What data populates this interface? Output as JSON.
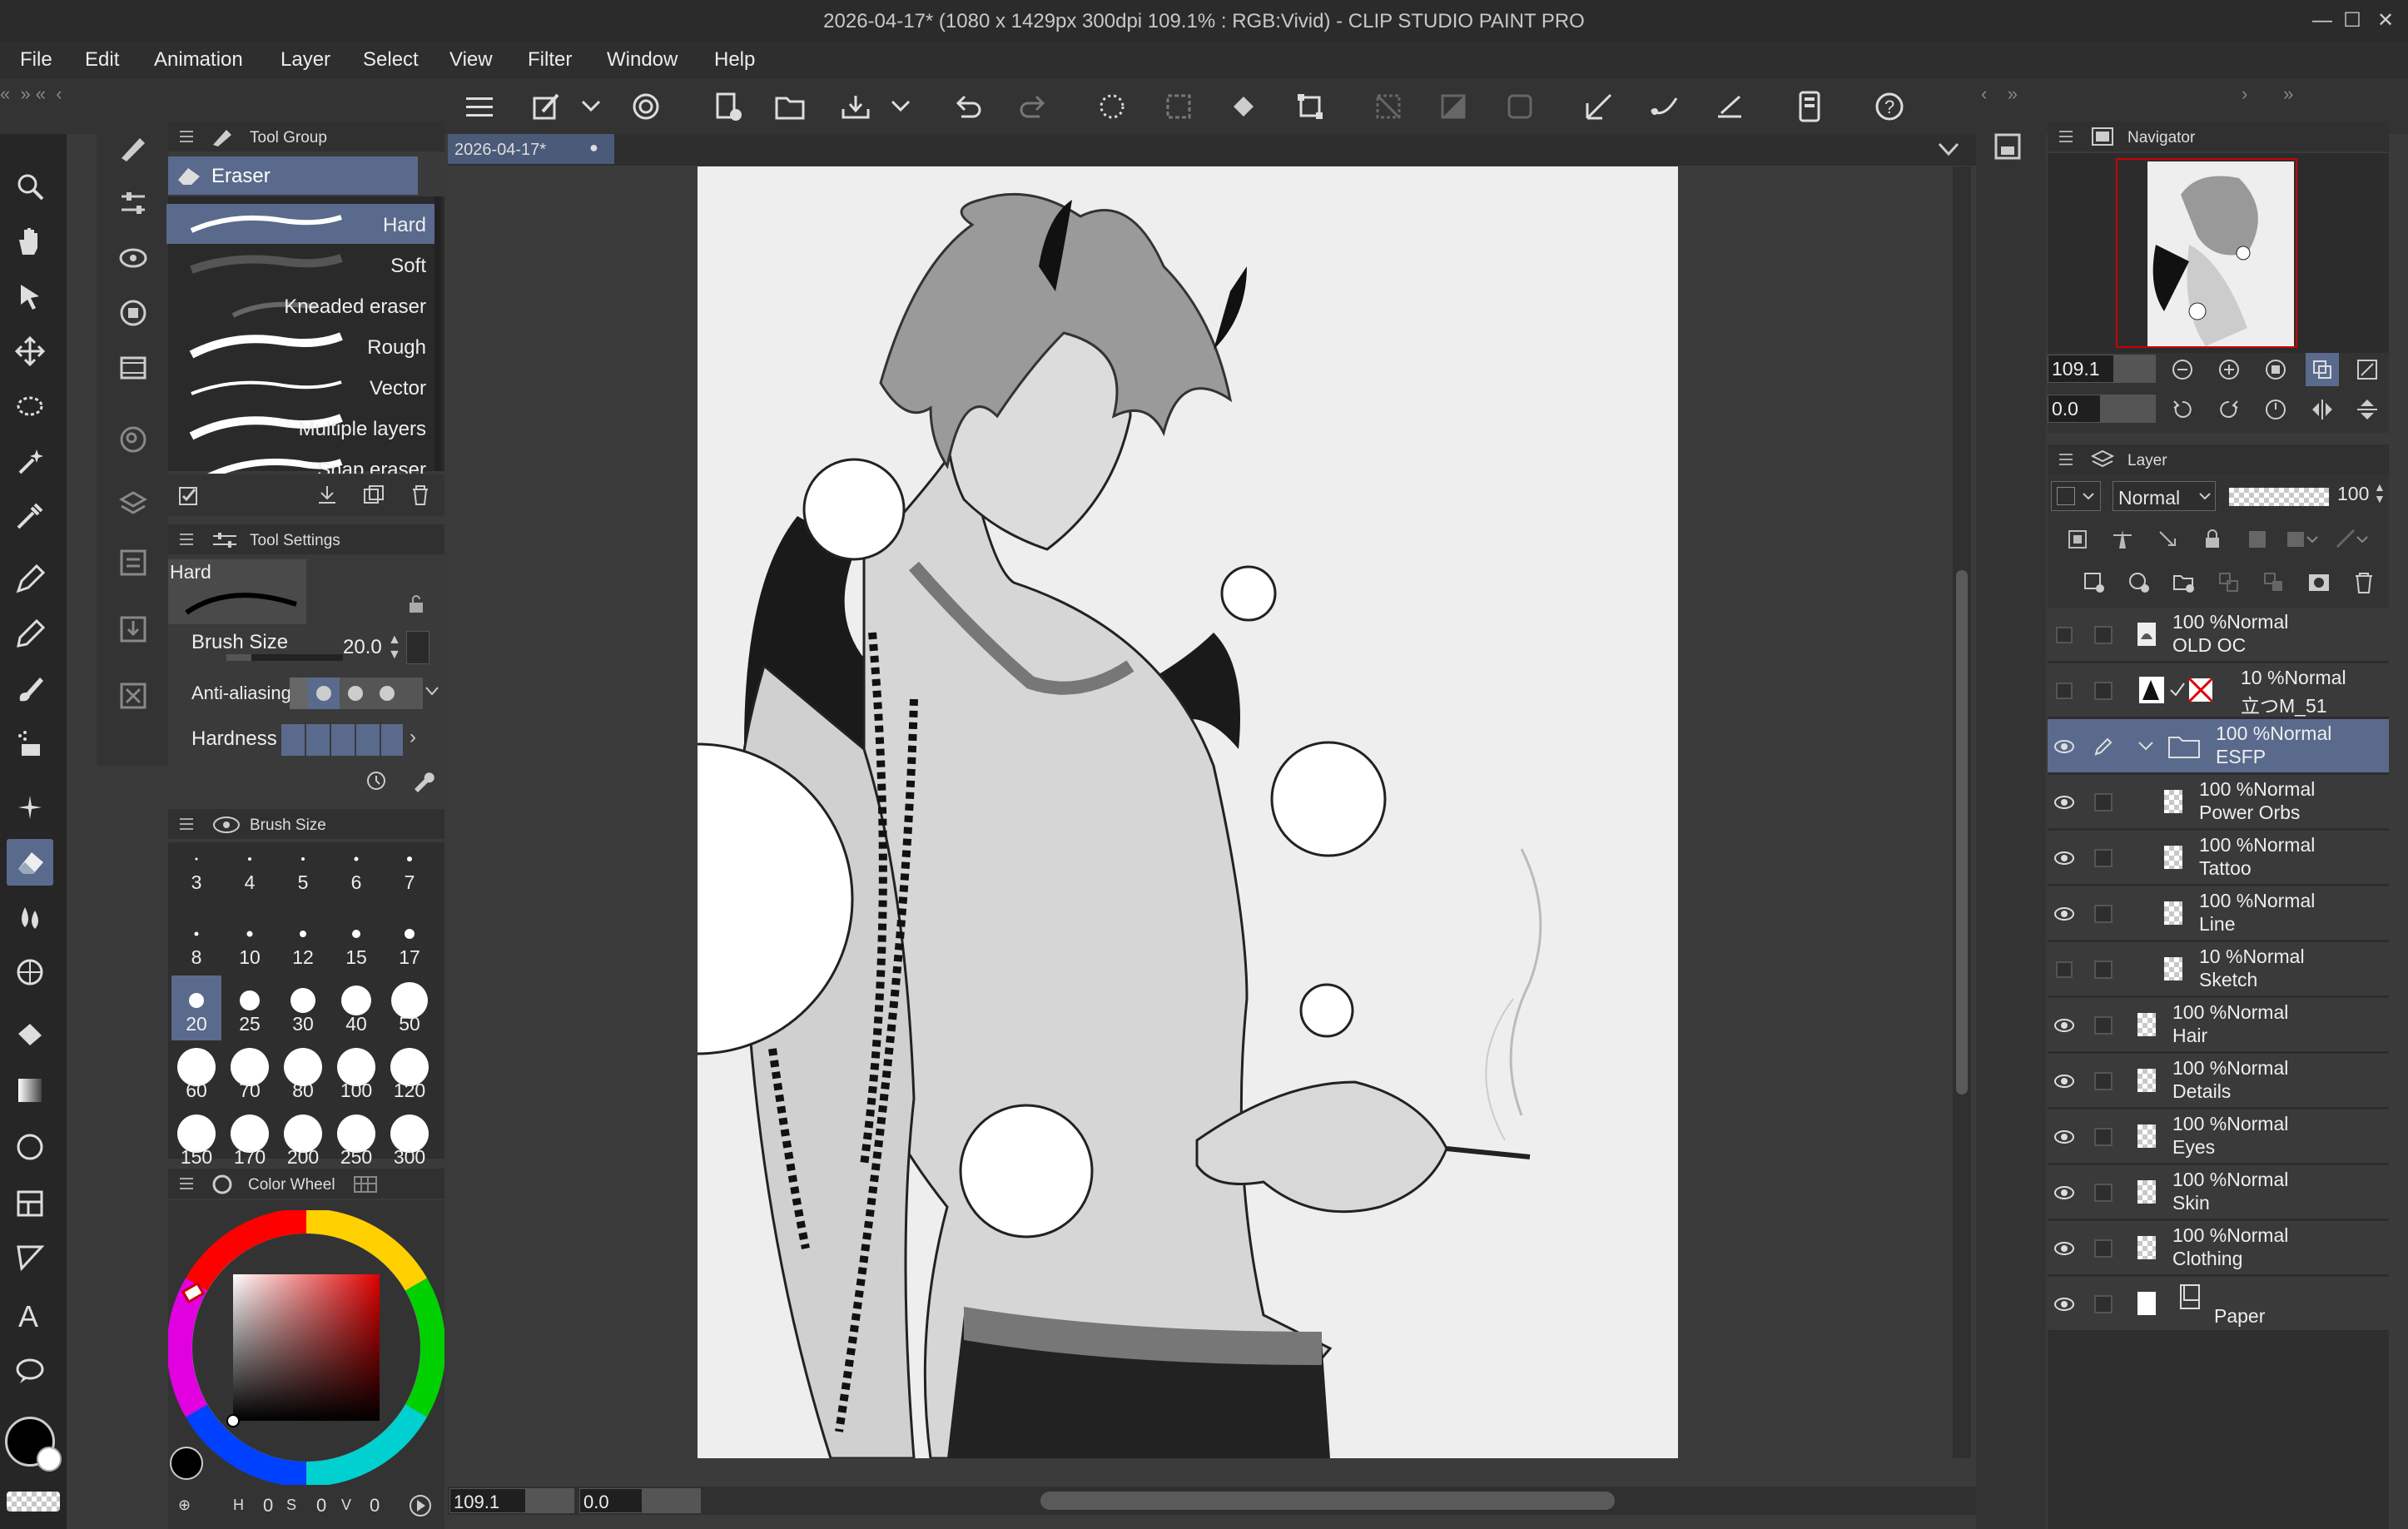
{
  "window": {
    "title": "2026-04-17* (1080 x 1429px 300dpi 109.1% : RGB:Vivid)  - CLIP STUDIO PAINT PRO",
    "min": "—",
    "max": "☐",
    "close": "✕"
  },
  "menu": [
    "File",
    "Edit",
    "Animation",
    "Layer",
    "Select",
    "View",
    "Filter",
    "Window",
    "Help"
  ],
  "tab": {
    "label": "2026-04-17*"
  },
  "tool_group": {
    "title": "Tool Group",
    "active": "Eraser"
  },
  "brushes": [
    {
      "name": "Hard",
      "selected": true
    },
    {
      "name": "Soft"
    },
    {
      "name": "Kneaded eraser"
    },
    {
      "name": "Rough"
    },
    {
      "name": "Vector"
    },
    {
      "name": "Multiple layers"
    },
    {
      "name": "Snap eraser"
    }
  ],
  "tool_settings": {
    "title": "Tool Settings",
    "preset": "Hard",
    "brush_size_label": "Brush Size",
    "brush_size": "20.0",
    "antialias_label": "Anti-aliasing",
    "hardness_label": "Hardness"
  },
  "brush_size_panel": {
    "title": "Brush Size",
    "sizes": [
      "3",
      "4",
      "5",
      "6",
      "7",
      "8",
      "10",
      "12",
      "15",
      "17",
      "20",
      "25",
      "30",
      "40",
      "50",
      "60",
      "70",
      "80",
      "100",
      "120",
      "150",
      "170",
      "200",
      "250",
      "300"
    ],
    "selected": "20"
  },
  "color_wheel": {
    "title": "Color Wheel",
    "h_label": "H",
    "h": "0",
    "s_label": "S",
    "s": "0",
    "v_label": "V",
    "v": "0",
    "main_color": "#000000"
  },
  "canvas_status": {
    "zoom": "109.1",
    "rotation": "0.0"
  },
  "navigator": {
    "title": "Navigator",
    "zoom": "109.1",
    "angle": "0.0"
  },
  "layer_panel": {
    "title": "Layer",
    "blend_mode": "Normal",
    "opacity": "100"
  },
  "layers": [
    {
      "pct": "100 %",
      "mode": "Normal",
      "name": "OLD OC",
      "visible": false,
      "indent": 0,
      "thumb": "image"
    },
    {
      "pct": "10 %",
      "mode": "Normal",
      "name": "立つM_51",
      "visible": false,
      "indent": 0,
      "thumb": "ref"
    },
    {
      "pct": "100 %",
      "mode": "Normal",
      "name": "ESFP",
      "visible": true,
      "indent": 0,
      "thumb": "folder",
      "selected": true
    },
    {
      "pct": "100 %",
      "mode": "Normal",
      "name": "Power Orbs",
      "visible": true,
      "indent": 1,
      "thumb": "checker"
    },
    {
      "pct": "100 %",
      "mode": "Normal",
      "name": "Tattoo",
      "visible": true,
      "indent": 1,
      "thumb": "checker"
    },
    {
      "pct": "100 %",
      "mode": "Normal",
      "name": "Line",
      "visible": true,
      "indent": 1,
      "thumb": "checker"
    },
    {
      "pct": "10 %",
      "mode": "Normal",
      "name": "Sketch",
      "visible": false,
      "indent": 1,
      "thumb": "checker"
    },
    {
      "pct": "100 %",
      "mode": "Normal",
      "name": "Hair",
      "visible": true,
      "indent": 0,
      "thumb": "checker"
    },
    {
      "pct": "100 %",
      "mode": "Normal",
      "name": "Details",
      "visible": true,
      "indent": 0,
      "thumb": "checker"
    },
    {
      "pct": "100 %",
      "mode": "Normal",
      "name": "Eyes",
      "visible": true,
      "indent": 0,
      "thumb": "checker"
    },
    {
      "pct": "100 %",
      "mode": "Normal",
      "name": "Skin",
      "visible": true,
      "indent": 0,
      "thumb": "checker"
    },
    {
      "pct": "100 %",
      "mode": "Normal",
      "name": "Clothing",
      "visible": true,
      "indent": 0,
      "thumb": "checker"
    },
    {
      "pct": "",
      "mode": "",
      "name": "Paper",
      "visible": true,
      "indent": 0,
      "thumb": "paper"
    }
  ],
  "colors": {
    "accent": "#5a6a8c",
    "bg": "#3a3a3a",
    "canvas_bg": "#eeeeee"
  }
}
